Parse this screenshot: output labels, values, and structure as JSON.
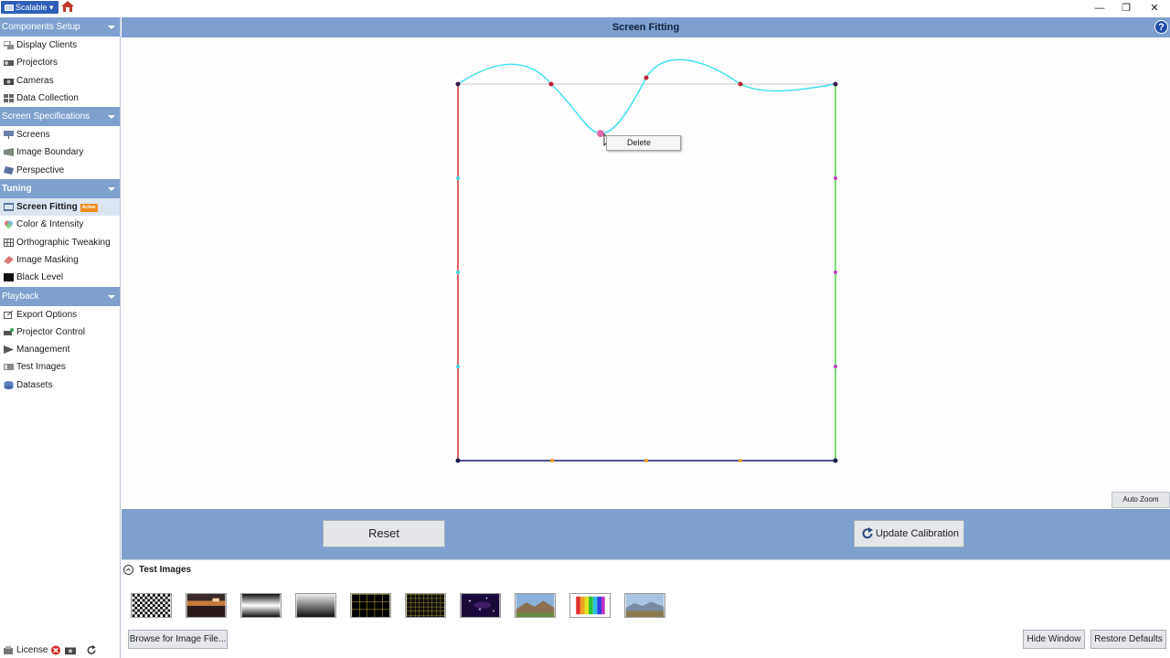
{
  "app": {
    "menu_label": "Scalable",
    "home_icon": "home-icon",
    "window_controls": [
      "—",
      "❐",
      "✕"
    ]
  },
  "sidebar": {
    "sections": [
      {
        "title": "Components Setup",
        "items": [
          {
            "label": "Display Clients",
            "icon": "display-clients-icon"
          },
          {
            "label": "Projectors",
            "icon": "projector-icon"
          },
          {
            "label": "Cameras",
            "icon": "camera-icon"
          },
          {
            "label": "Data Collection",
            "icon": "data-collection-icon"
          }
        ]
      },
      {
        "title": "Screen Specifications",
        "items": [
          {
            "label": "Screens",
            "icon": "screens-icon"
          },
          {
            "label": "Image Boundary",
            "icon": "image-boundary-icon"
          },
          {
            "label": "Perspective",
            "icon": "perspective-icon"
          }
        ]
      },
      {
        "title": "Tuning",
        "items": [
          {
            "label": "Screen Fitting",
            "icon": "screen-fitting-icon",
            "badge": "Active"
          },
          {
            "label": "Color & Intensity",
            "icon": "color-intensity-icon"
          },
          {
            "label": "Orthographic Tweaking",
            "icon": "grid-icon"
          },
          {
            "label": "Image Masking",
            "icon": "eraser-icon"
          },
          {
            "label": "Black Level",
            "icon": "black-level-icon"
          }
        ]
      },
      {
        "title": "Playback",
        "items": [
          {
            "label": "Export Options",
            "icon": "export-icon"
          },
          {
            "label": "Projector Control",
            "icon": "projector-control-icon"
          },
          {
            "label": "Management",
            "icon": "management-icon"
          },
          {
            "label": "Test Images",
            "icon": "test-images-icon"
          },
          {
            "label": "Datasets",
            "icon": "database-icon"
          }
        ]
      }
    ],
    "footer": {
      "license_label": "License"
    }
  },
  "main": {
    "title": "Screen Fitting",
    "help_label": "?",
    "auto_zoom_label": "Auto Zoom",
    "context_menu": {
      "items": [
        "Delete"
      ]
    },
    "reset_label": "Reset",
    "update_label": "Update Calibration"
  },
  "test_images": {
    "title": "Test Images",
    "thumbnails": [
      "checkerboard",
      "sunset-photo",
      "horizontal-gradient",
      "vertical-gradient",
      "yellow-grid",
      "fine-yellow-grid",
      "starfield",
      "landscape-photo",
      "color-bars",
      "mountain-photo"
    ],
    "browse_label": "Browse for Image File...",
    "hide_label": "Hide Window",
    "restore_label": "Restore Defaults"
  },
  "colors": {
    "header_blue": "#7f9fcf",
    "accent_orange": "#f08c1a",
    "curve_cyan": "#40e0f0",
    "left_edge_red": "#d03030",
    "right_edge_green": "#4cd04c",
    "bottom_edge_navy": "#1a1a6e"
  }
}
